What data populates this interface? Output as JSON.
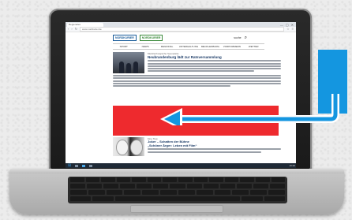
{
  "browser": {
    "tab_title": "Regionales",
    "url": "www.nordkurier.de",
    "window_controls": [
      "—",
      "▢",
      "✕"
    ]
  },
  "site": {
    "brands": [
      "NORDKURIER",
      "NORDKURIER"
    ],
    "header_text": "suche",
    "nav": [
      "SPORT",
      "NEWS",
      "REGIONAL",
      "UNTERHALTUNG",
      "MECKLENBURG",
      "VORPOMMERN",
      "WETTER"
    ]
  },
  "article1": {
    "kicker": "Mecklenburgische Seenplatte",
    "headline": "Neubrandenburg lädt zur Ratsversammlung"
  },
  "article2": {
    "kicker": "Kino Tipp",
    "headline1": "Joker – Schatten der Bühne",
    "headline2": "„Schöner Ärger: Leben mit Film“"
  },
  "taskbar": {
    "windows_icon": "⊞",
    "clock": "10:20"
  },
  "colors": {
    "ad_red": "#ee2a2e",
    "arrow_blue": "#1496e0"
  }
}
